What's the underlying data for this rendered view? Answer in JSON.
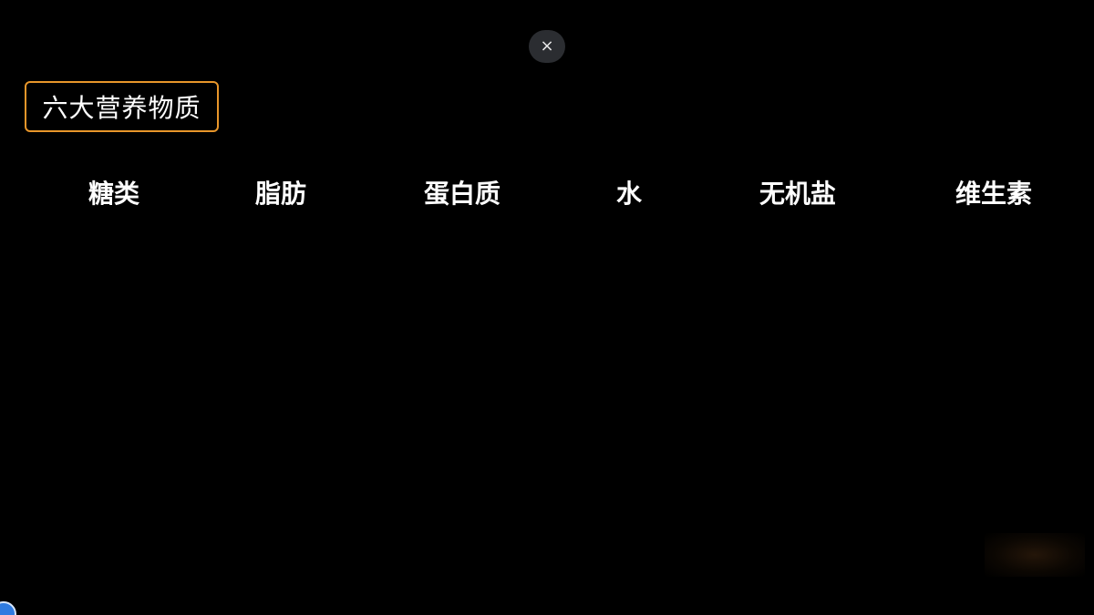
{
  "overlay": {
    "close_label": "×"
  },
  "title": "六大营养物质",
  "nutrients": [
    "糖类",
    "脂肪",
    "蛋白质",
    "水",
    "无机盐",
    "维生素"
  ],
  "colors": {
    "background": "#000000",
    "title_border": "#e8962a",
    "close_button_bg": "#2b2d31",
    "text": "#ffffff"
  }
}
